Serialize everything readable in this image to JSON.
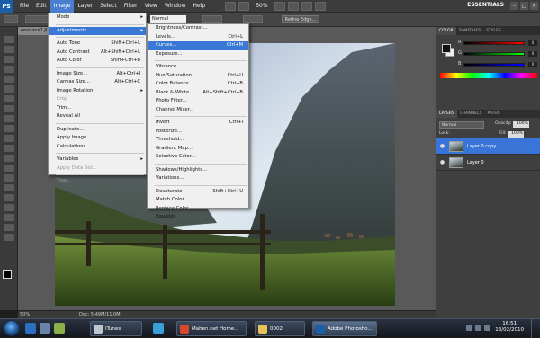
{
  "app": {
    "logo": "Ps",
    "workspace": "ESSENTIALS",
    "zoom": "50%"
  },
  "menubar": [
    "File",
    "Edit",
    "Image",
    "Layer",
    "Select",
    "Filter",
    "View",
    "Window",
    "Help"
  ],
  "options": {
    "style": "Normal",
    "refine_edge": "Refine Edge..."
  },
  "document": {
    "tab": "resource1.JI",
    "status_zoom": "50%",
    "status_doc": "Doc: 5.49M/11.0M"
  },
  "image_menu": [
    {
      "label": "Mode",
      "arrow": true
    },
    {
      "sep": true
    },
    {
      "label": "Adjustments",
      "arrow": true,
      "highlight": true
    },
    {
      "sep": true
    },
    {
      "label": "Auto Tone",
      "shortcut": "Shift+Ctrl+L"
    },
    {
      "label": "Auto Contrast",
      "shortcut": "Alt+Shift+Ctrl+L"
    },
    {
      "label": "Auto Color",
      "shortcut": "Shift+Ctrl+B"
    },
    {
      "sep": true
    },
    {
      "label": "Image Size...",
      "shortcut": "Alt+Ctrl+I"
    },
    {
      "label": "Canvas Size...",
      "shortcut": "Alt+Ctrl+C"
    },
    {
      "label": "Image Rotation",
      "arrow": true
    },
    {
      "label": "Crop",
      "disabled": true
    },
    {
      "label": "Trim..."
    },
    {
      "label": "Reveal All"
    },
    {
      "sep": true
    },
    {
      "label": "Duplicate..."
    },
    {
      "label": "Apply Image..."
    },
    {
      "label": "Calculations..."
    },
    {
      "sep": true
    },
    {
      "label": "Variables",
      "arrow": true
    },
    {
      "label": "Apply Data Set...",
      "disabled": true
    },
    {
      "sep": true
    },
    {
      "label": "Trap...",
      "disabled": true
    }
  ],
  "adjustments_menu": [
    {
      "label": "Brightness/Contrast..."
    },
    {
      "label": "Levels...",
      "shortcut": "Ctrl+L"
    },
    {
      "label": "Curves...",
      "shortcut": "Ctrl+M",
      "highlight": true
    },
    {
      "label": "Exposure..."
    },
    {
      "sep": true
    },
    {
      "label": "Vibrance..."
    },
    {
      "label": "Hue/Saturation...",
      "shortcut": "Ctrl+U"
    },
    {
      "label": "Color Balance...",
      "shortcut": "Ctrl+B"
    },
    {
      "label": "Black & White...",
      "shortcut": "Alt+Shift+Ctrl+B"
    },
    {
      "label": "Photo Filter..."
    },
    {
      "label": "Channel Mixer..."
    },
    {
      "sep": true
    },
    {
      "label": "Invert",
      "shortcut": "Ctrl+I"
    },
    {
      "label": "Posterize..."
    },
    {
      "label": "Threshold..."
    },
    {
      "label": "Gradient Map..."
    },
    {
      "label": "Selective Color..."
    },
    {
      "sep": true
    },
    {
      "label": "Shadows/Highlights..."
    },
    {
      "label": "Variations..."
    },
    {
      "sep": true
    },
    {
      "label": "Desaturate",
      "shortcut": "Shift+Ctrl+U"
    },
    {
      "label": "Match Color..."
    },
    {
      "label": "Replace Color..."
    },
    {
      "label": "Equalize"
    }
  ],
  "color_panel": {
    "tabs": [
      "COLOR",
      "SWATCHES",
      "STYLES"
    ],
    "channels": [
      {
        "label": "R",
        "value": "0",
        "gradient": "#ff0000"
      },
      {
        "label": "G",
        "value": "0",
        "gradient": "#00ff00"
      },
      {
        "label": "B",
        "value": "0",
        "gradient": "#0000ff"
      }
    ]
  },
  "layers_panel": {
    "tabs": [
      "LAYERS",
      "CHANNELS",
      "PATHS"
    ],
    "blend": "Normal",
    "opacity_label": "Opacity:",
    "opacity": "100%",
    "lock_label": "Lock:",
    "fill_label": "Fill:",
    "fill": "100%",
    "layers": [
      {
        "name": "Layer 0 copy",
        "selected": true
      },
      {
        "name": "Layer 0",
        "selected": false
      }
    ]
  },
  "taskbar": {
    "buttons": [
      {
        "label": "iTunes",
        "color": "#c0c6d0"
      },
      {
        "label": "Mahen.net Home...",
        "color": "#d44a2a"
      },
      {
        "label": "0002",
        "color": "#e8c15a"
      },
      {
        "label": "Adobe Photosho...",
        "color": "#1b5fa8"
      }
    ],
    "time": "16:51",
    "date": "13/02/2010"
  }
}
